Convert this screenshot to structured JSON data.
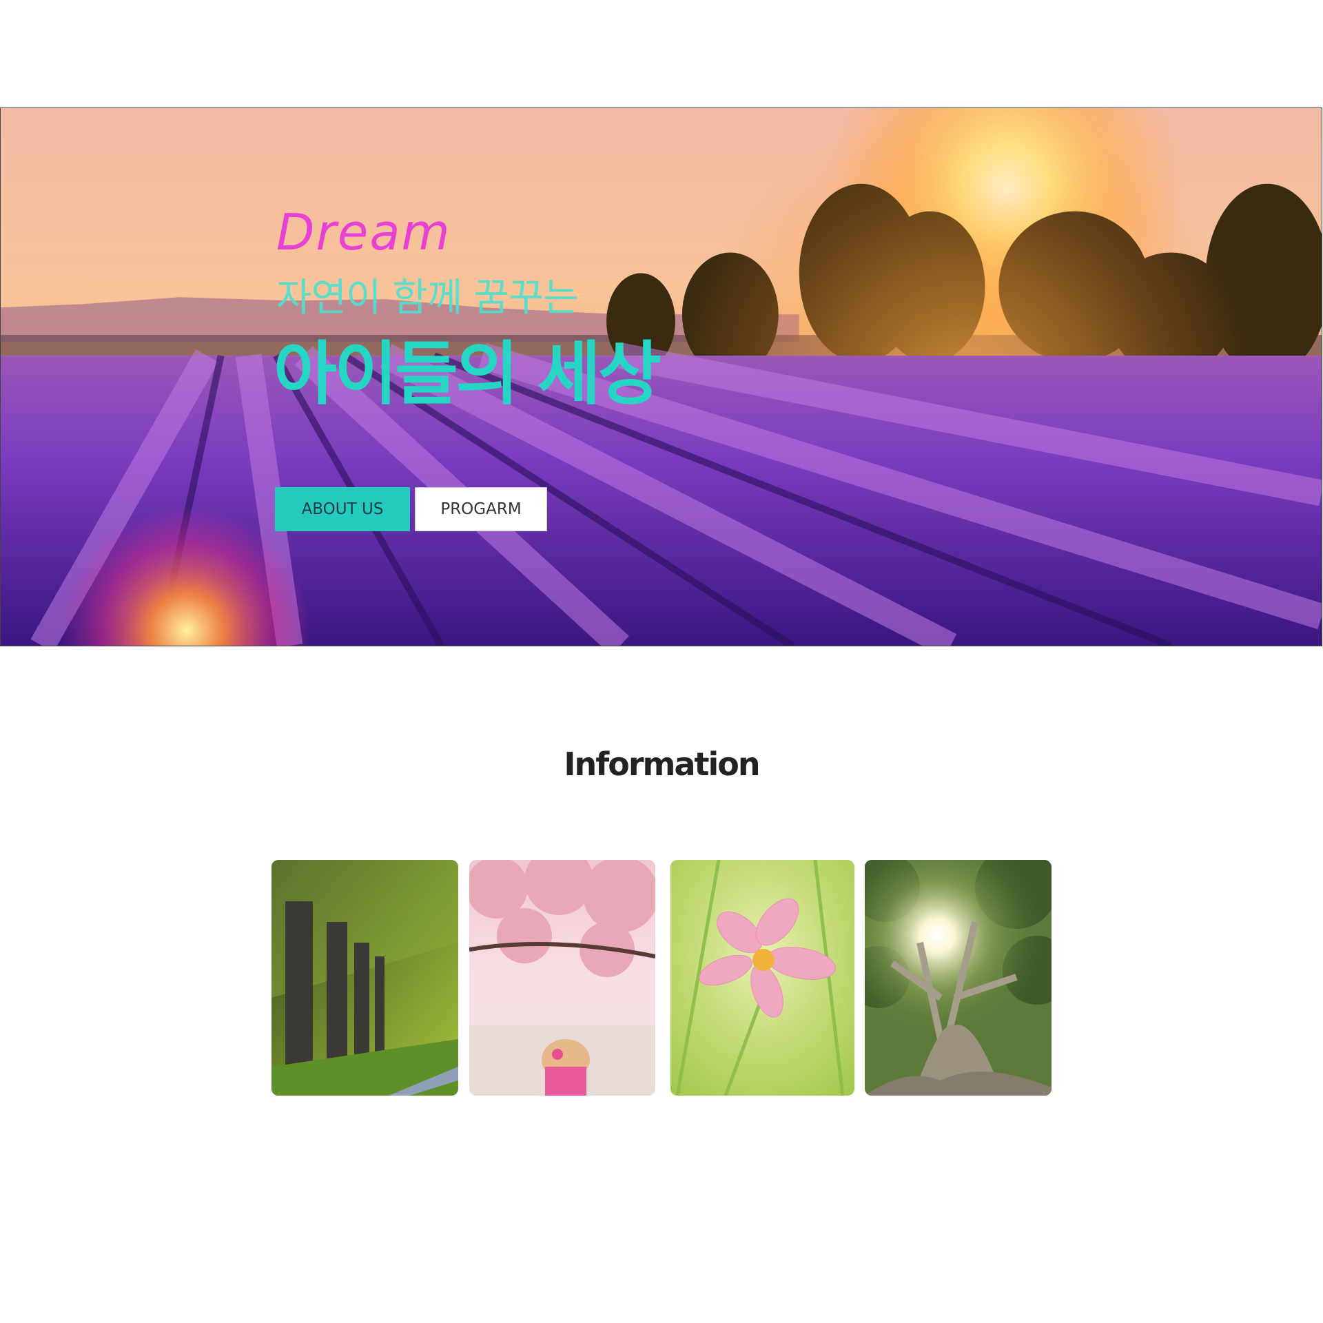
{
  "hero": {
    "kicker": "Dream",
    "subtitle": "자연이 함께 꿈꾸는",
    "headline": "아이들의 세상",
    "about_button": "ABOUT US",
    "program_button": "PROGARM",
    "background": "lavender-field-sunset-photo"
  },
  "information": {
    "title": "Information",
    "cards": [
      {
        "image": "tree-lined-avenue-photo"
      },
      {
        "image": "cherry-blossom-child-photo"
      },
      {
        "image": "pink-cosmos-flower-photo"
      },
      {
        "image": "large-tree-sunburst-photo"
      }
    ]
  },
  "colors": {
    "kicker": "#e83fd4",
    "accent": "#26d6c4",
    "about_button_bg": "#22cbbd",
    "program_button_bg": "#ffffff"
  }
}
